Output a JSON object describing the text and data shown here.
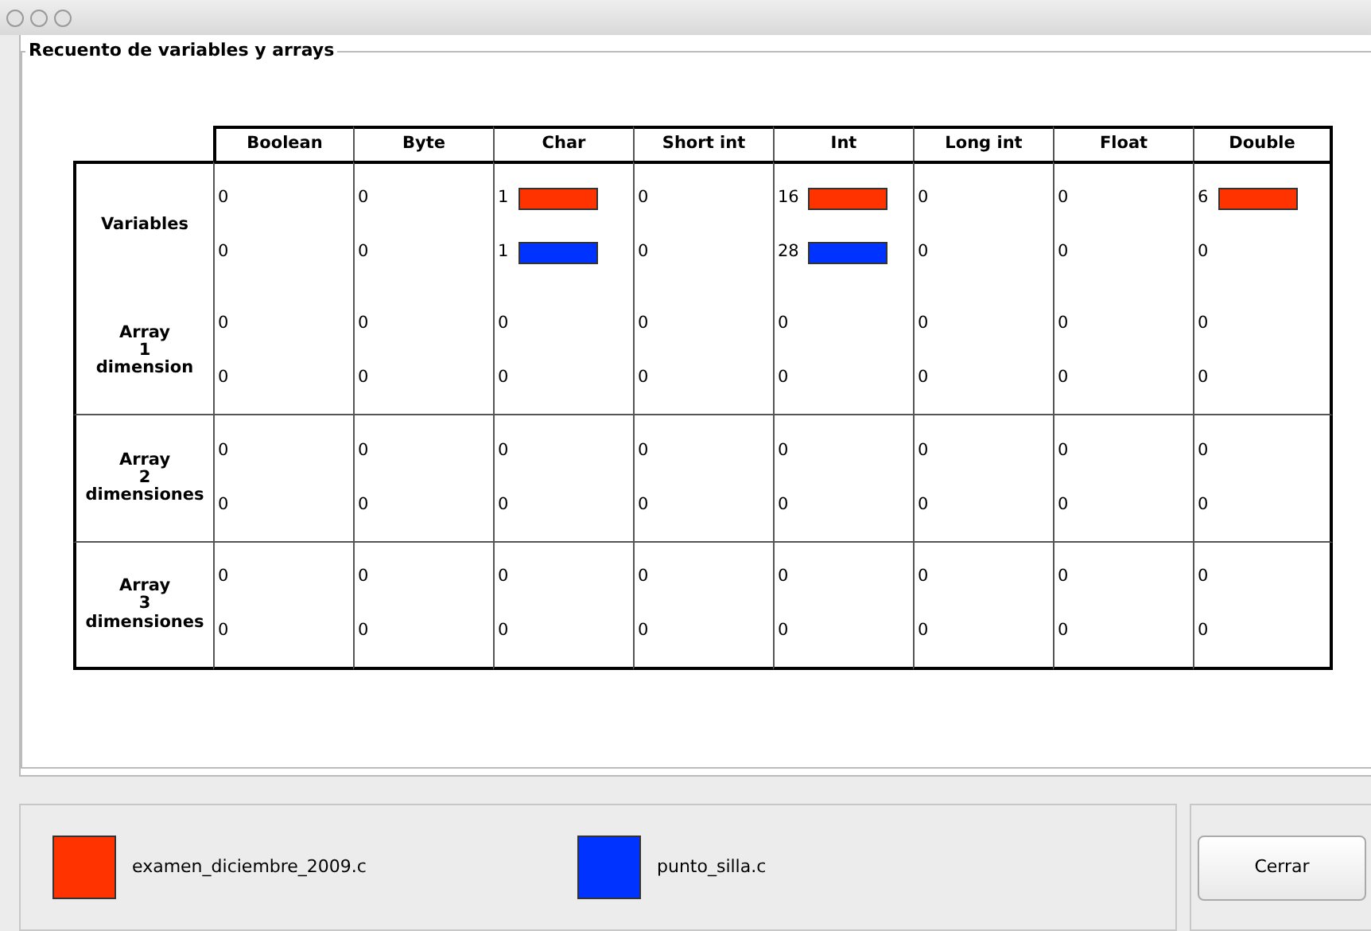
{
  "panel": {
    "title": "Recuento de variables y arrays"
  },
  "table": {
    "columns": [
      "Boolean",
      "Byte",
      "Char",
      "Short int",
      "Int",
      "Long int",
      "Float",
      "Double"
    ],
    "row_groups": [
      {
        "label_lines": [
          "Variables"
        ],
        "ruled_below": false,
        "lines": [
          [
            {
              "value": "0"
            },
            {
              "value": "0"
            },
            {
              "value": "1",
              "bar": {
                "color": "#ff3300"
              }
            },
            {
              "value": "0"
            },
            {
              "value": "16",
              "bar": {
                "color": "#ff3300"
              }
            },
            {
              "value": "0"
            },
            {
              "value": "0"
            },
            {
              "value": "6",
              "bar": {
                "color": "#ff3300"
              }
            }
          ],
          [
            {
              "value": "0"
            },
            {
              "value": "0"
            },
            {
              "value": "1",
              "bar": {
                "color": "#0033ff"
              }
            },
            {
              "value": "0"
            },
            {
              "value": "28",
              "bar": {
                "color": "#0033ff"
              }
            },
            {
              "value": "0"
            },
            {
              "value": "0"
            },
            {
              "value": "0"
            }
          ]
        ]
      },
      {
        "label_lines": [
          "Array",
          "1",
          "dimension"
        ],
        "ruled_below": true,
        "lines": [
          [
            {
              "value": "0"
            },
            {
              "value": "0"
            },
            {
              "value": "0"
            },
            {
              "value": "0"
            },
            {
              "value": "0"
            },
            {
              "value": "0"
            },
            {
              "value": "0"
            },
            {
              "value": "0"
            }
          ],
          [
            {
              "value": "0"
            },
            {
              "value": "0"
            },
            {
              "value": "0"
            },
            {
              "value": "0"
            },
            {
              "value": "0"
            },
            {
              "value": "0"
            },
            {
              "value": "0"
            },
            {
              "value": "0"
            }
          ]
        ]
      },
      {
        "label_lines": [
          "Array",
          "2",
          "dimensiones"
        ],
        "ruled_below": true,
        "lines": [
          [
            {
              "value": "0"
            },
            {
              "value": "0"
            },
            {
              "value": "0"
            },
            {
              "value": "0"
            },
            {
              "value": "0"
            },
            {
              "value": "0"
            },
            {
              "value": "0"
            },
            {
              "value": "0"
            }
          ],
          [
            {
              "value": "0"
            },
            {
              "value": "0"
            },
            {
              "value": "0"
            },
            {
              "value": "0"
            },
            {
              "value": "0"
            },
            {
              "value": "0"
            },
            {
              "value": "0"
            },
            {
              "value": "0"
            }
          ]
        ]
      },
      {
        "label_lines": [
          "Array",
          "3",
          "dimensiones"
        ],
        "ruled_below": false,
        "lines": [
          [
            {
              "value": "0"
            },
            {
              "value": "0"
            },
            {
              "value": "0"
            },
            {
              "value": "0"
            },
            {
              "value": "0"
            },
            {
              "value": "0"
            },
            {
              "value": "0"
            },
            {
              "value": "0"
            }
          ],
          [
            {
              "value": "0"
            },
            {
              "value": "0"
            },
            {
              "value": "0"
            },
            {
              "value": "0"
            },
            {
              "value": "0"
            },
            {
              "value": "0"
            },
            {
              "value": "0"
            },
            {
              "value": "0"
            }
          ]
        ]
      }
    ]
  },
  "legend": [
    {
      "name": "examen_diciembre_2009.c",
      "color": "#ff3300"
    },
    {
      "name": "punto_silla.c",
      "color": "#0033ff"
    }
  ],
  "buttons": [
    "Cerrar"
  ]
}
